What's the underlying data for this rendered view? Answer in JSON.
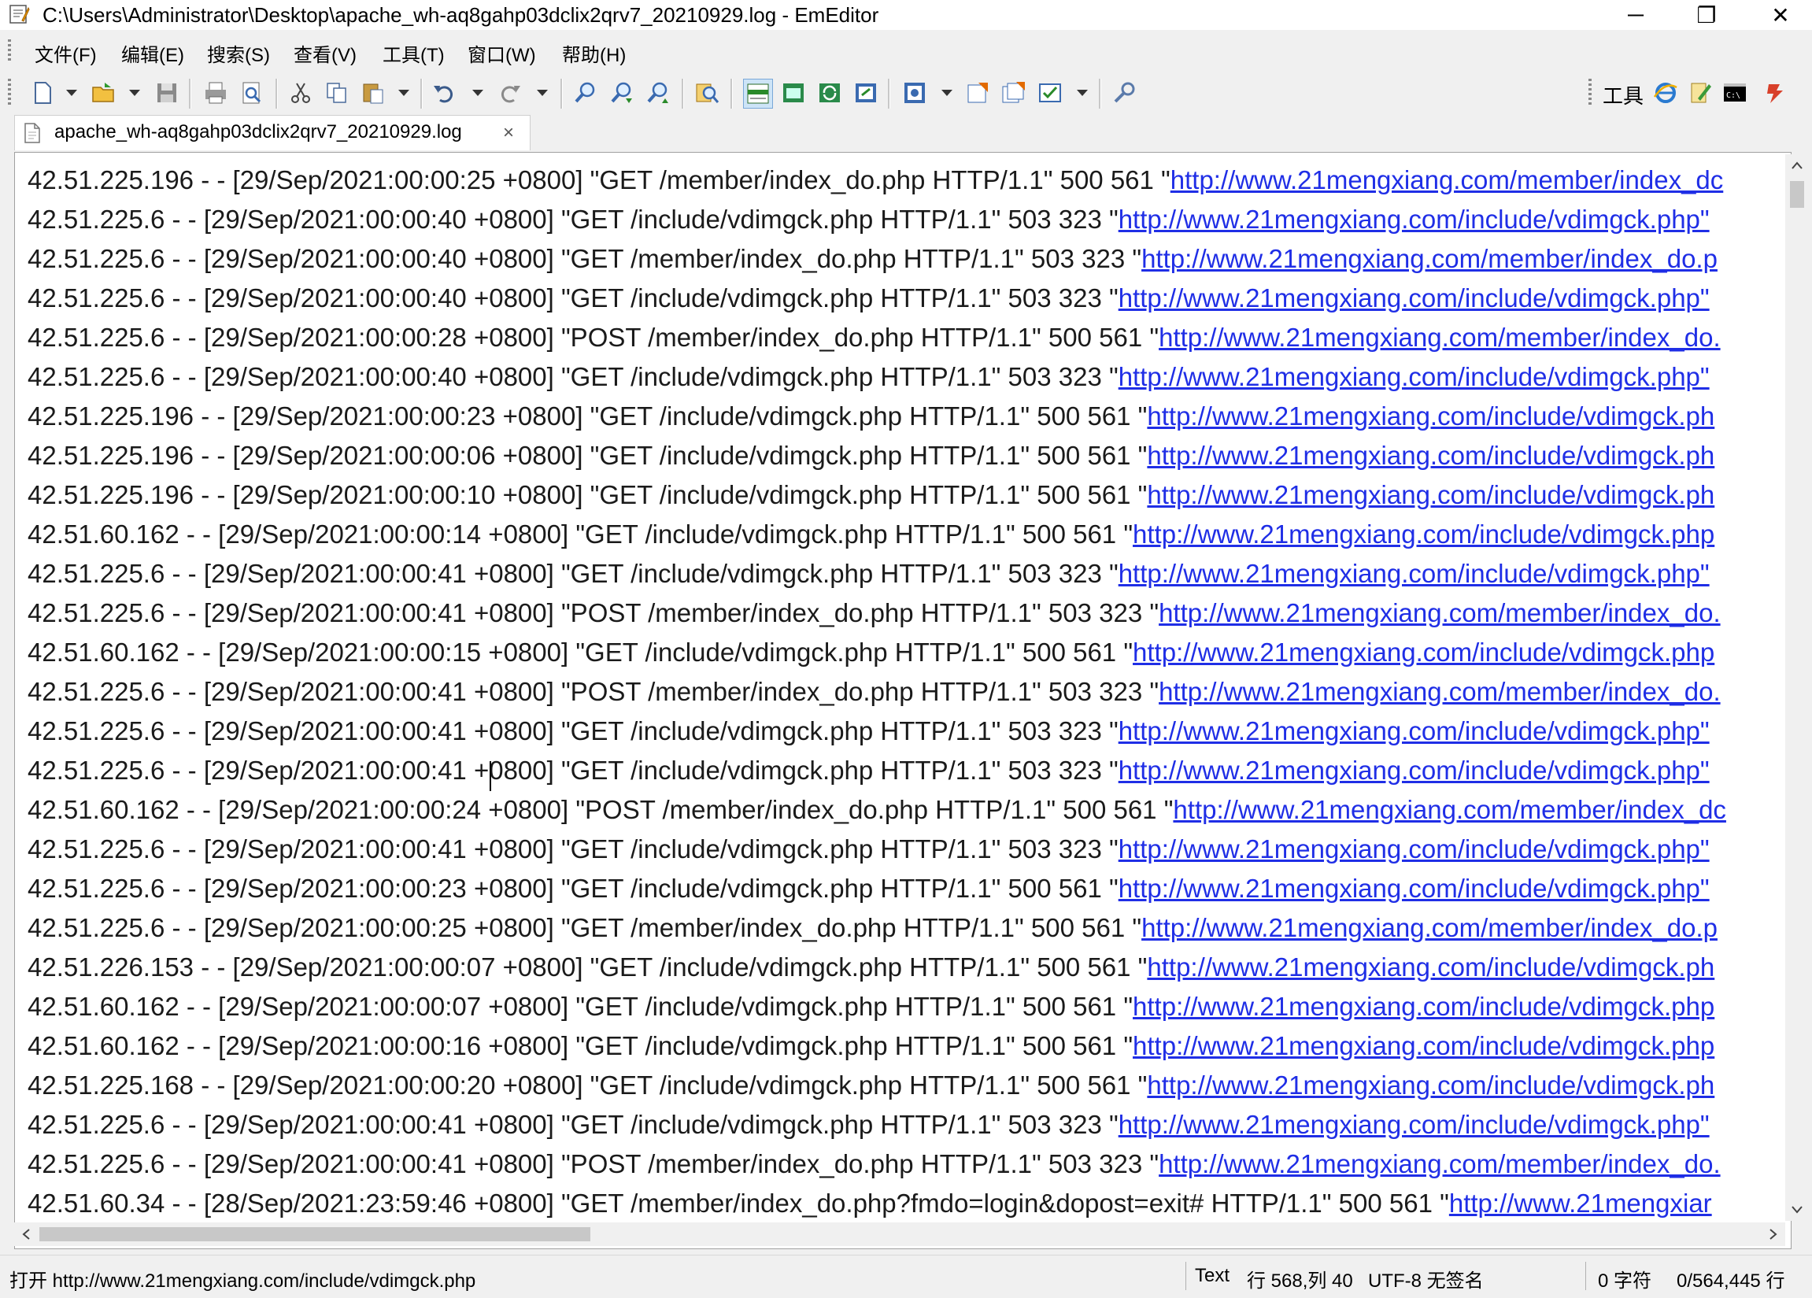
{
  "window": {
    "title": "C:\\Users\\Administrator\\Desktop\\apache_wh-aq8gahp03dclix2qrv7_20210929.log - EmEditor",
    "minimize": "─",
    "maximize": "❐",
    "close": "✕"
  },
  "menu": [
    "文件(F)",
    "编辑(E)",
    "搜索(S)",
    "查看(V)",
    "工具(T)",
    "窗口(W)",
    "帮助(H)"
  ],
  "toolbar": {
    "tools_label": "工具"
  },
  "tab": {
    "label": "apache_wh-aq8gahp03dclix2qrv7_20210929.log",
    "close": "×"
  },
  "log_lines": [
    {
      "text": "42.51.225.196 - - [29/Sep/2021:00:00:25 +0800] \"GET /member/index_do.php HTTP/1.1\" 500 561 \"",
      "url": "http://www.21mengxiang.com/member/index_dc"
    },
    {
      "text": "42.51.225.6 - - [29/Sep/2021:00:00:40 +0800] \"GET /include/vdimgck.php HTTP/1.1\" 503 323 \"",
      "url": "http://www.21mengxiang.com/include/vdimgck.php\""
    },
    {
      "text": "42.51.225.6 - - [29/Sep/2021:00:00:40 +0800] \"GET /member/index_do.php HTTP/1.1\" 503 323 \"",
      "url": "http://www.21mengxiang.com/member/index_do.p"
    },
    {
      "text": "42.51.225.6 - - [29/Sep/2021:00:00:40 +0800] \"GET /include/vdimgck.php HTTP/1.1\" 503 323 \"",
      "url": "http://www.21mengxiang.com/include/vdimgck.php\""
    },
    {
      "text": "42.51.225.6 - - [29/Sep/2021:00:00:28 +0800] \"POST /member/index_do.php HTTP/1.1\" 500 561 \"",
      "url": "http://www.21mengxiang.com/member/index_do."
    },
    {
      "text": "42.51.225.6 - - [29/Sep/2021:00:00:40 +0800] \"GET /include/vdimgck.php HTTP/1.1\" 503 323 \"",
      "url": "http://www.21mengxiang.com/include/vdimgck.php\""
    },
    {
      "text": "42.51.225.196 - - [29/Sep/2021:00:00:23 +0800] \"GET /include/vdimgck.php HTTP/1.1\" 500 561 \"",
      "url": "http://www.21mengxiang.com/include/vdimgck.ph"
    },
    {
      "text": "42.51.225.196 - - [29/Sep/2021:00:00:06 +0800] \"GET /include/vdimgck.php HTTP/1.1\" 500 561 \"",
      "url": "http://www.21mengxiang.com/include/vdimgck.ph"
    },
    {
      "text": "42.51.225.196 - - [29/Sep/2021:00:00:10 +0800] \"GET /include/vdimgck.php HTTP/1.1\" 500 561 \"",
      "url": "http://www.21mengxiang.com/include/vdimgck.ph"
    },
    {
      "text": "42.51.60.162 - - [29/Sep/2021:00:00:14 +0800] \"GET /include/vdimgck.php HTTP/1.1\" 500 561 \"",
      "url": "http://www.21mengxiang.com/include/vdimgck.php"
    },
    {
      "text": "42.51.225.6 - - [29/Sep/2021:00:00:41 +0800] \"GET /include/vdimgck.php HTTP/1.1\" 503 323 \"",
      "url": "http://www.21mengxiang.com/include/vdimgck.php\""
    },
    {
      "text": "42.51.225.6 - - [29/Sep/2021:00:00:41 +0800] \"POST /member/index_do.php HTTP/1.1\" 503 323 \"",
      "url": "http://www.21mengxiang.com/member/index_do."
    },
    {
      "text": "42.51.60.162 - - [29/Sep/2021:00:00:15 +0800] \"GET /include/vdimgck.php HTTP/1.1\" 500 561 \"",
      "url": "http://www.21mengxiang.com/include/vdimgck.php"
    },
    {
      "text": "42.51.225.6 - - [29/Sep/2021:00:00:41 +0800] \"POST /member/index_do.php HTTP/1.1\" 503 323 \"",
      "url": "http://www.21mengxiang.com/member/index_do."
    },
    {
      "text": "42.51.225.6 - - [29/Sep/2021:00:00:41 +0800] \"GET /include/vdimgck.php HTTP/1.1\" 503 323 \"",
      "url": "http://www.21mengxiang.com/include/vdimgck.php\""
    },
    {
      "text": "42.51.225.6 - - [29/Sep/2021:00:00:41 +0800] \"GET /include/vdimgck.php HTTP/1.1\" 503 323 \"",
      "url": "http://www.21mengxiang.com/include/vdimgck.php\""
    },
    {
      "text": "42.51.60.162 - - [29/Sep/2021:00:00:24 +0800] \"POST /member/index_do.php HTTP/1.1\" 500 561 \"",
      "url": "http://www.21mengxiang.com/member/index_dc"
    },
    {
      "text": "42.51.225.6 - - [29/Sep/2021:00:00:41 +0800] \"GET /include/vdimgck.php HTTP/1.1\" 503 323 \"",
      "url": "http://www.21mengxiang.com/include/vdimgck.php\""
    },
    {
      "text": "42.51.225.6 - - [29/Sep/2021:00:00:23 +0800] \"GET /include/vdimgck.php HTTP/1.1\" 500 561 \"",
      "url": "http://www.21mengxiang.com/include/vdimgck.php\""
    },
    {
      "text": "42.51.225.6 - - [29/Sep/2021:00:00:25 +0800] \"GET /member/index_do.php HTTP/1.1\" 500 561 \"",
      "url": "http://www.21mengxiang.com/member/index_do.p"
    },
    {
      "text": "42.51.226.153 - - [29/Sep/2021:00:00:07 +0800] \"GET /include/vdimgck.php HTTP/1.1\" 500 561 \"",
      "url": "http://www.21mengxiang.com/include/vdimgck.ph"
    },
    {
      "text": "42.51.60.162 - - [29/Sep/2021:00:00:07 +0800] \"GET /include/vdimgck.php HTTP/1.1\" 500 561 \"",
      "url": "http://www.21mengxiang.com/include/vdimgck.php"
    },
    {
      "text": "42.51.60.162 - - [29/Sep/2021:00:00:16 +0800] \"GET /include/vdimgck.php HTTP/1.1\" 500 561 \"",
      "url": "http://www.21mengxiang.com/include/vdimgck.php"
    },
    {
      "text": "42.51.225.168 - - [29/Sep/2021:00:00:20 +0800] \"GET /include/vdimgck.php HTTP/1.1\" 500 561 \"",
      "url": "http://www.21mengxiang.com/include/vdimgck.ph"
    },
    {
      "text": "42.51.225.6 - - [29/Sep/2021:00:00:41 +0800] \"GET /include/vdimgck.php HTTP/1.1\" 503 323 \"",
      "url": "http://www.21mengxiang.com/include/vdimgck.php\""
    },
    {
      "text": "42.51.225.6 - - [29/Sep/2021:00:00:41 +0800] \"POST /member/index_do.php HTTP/1.1\" 503 323 \"",
      "url": "http://www.21mengxiang.com/member/index_do."
    },
    {
      "text": "42.51.60.34 - - [28/Sep/2021:23:59:46 +0800] \"GET /member/index_do.php?fmdo=login&dopost=exit# HTTP/1.1\" 500 561 \"",
      "url": "http://www.21mengxiar"
    }
  ],
  "status": {
    "open_url": "打开 http://www.21mengxiang.com/include/vdimgck.php",
    "mode": "Text",
    "position": "行 568,列 40",
    "encoding": "UTF-8 无签名",
    "chars": "0 字符",
    "lines": "0/564,445 行"
  },
  "colors": {
    "url": "#1f2ee6",
    "text": "#1a1a1a",
    "chrome": "#f0f0f0"
  }
}
